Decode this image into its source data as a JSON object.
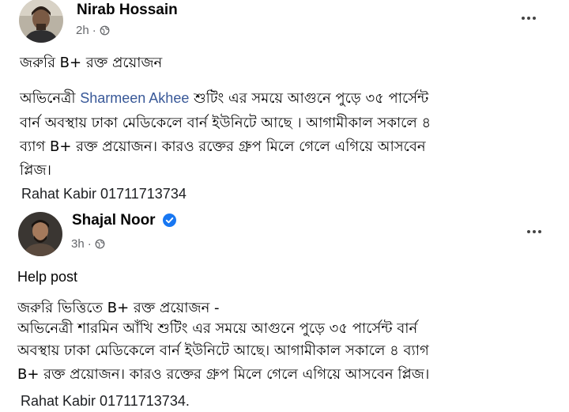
{
  "post1": {
    "author": "Nirab Hossain",
    "time": "2h",
    "separator": "·",
    "title": "জরুরি B+ রক্ত প্রয়োজন",
    "body_line1_prefix": "অভিনেত্রী",
    "body_line1_mention": "Sharmeen Akhee",
    "body_line1_suffix": "শুটিং এর সময়ে আগুনে পুড়ে ৩৫ পার্সেন্ট",
    "body_line2": "বার্ন অবস্থায় ঢাকা মেডিকেলে বার্ন ইউনিটে আছে । আগামীকাল সকালে ৪",
    "body_line3": "ব্যাগ B+ রক্ত প্রয়োজন। কারও রক্তের গ্রুপ মিলে গেলে এগিয়ে আসবেন",
    "body_line4": "প্লিজ।",
    "contact": "Rahat Kabir   01711713734",
    "icons": {
      "globe": "globe-icon",
      "more": "more-options-icon"
    }
  },
  "post2": {
    "author": "Shajal Noor",
    "time": "3h",
    "separator": "·",
    "intro": "Help post",
    "line1": "জরুরি ভিত্তিতে  B+ রক্ত প্রয়োজন -",
    "line2": "অভিনেত্রী শারমিন আঁখি শুটিং এর  সময়ে আগুনে পুড়ে ৩৫ পার্সেন্ট বার্ন",
    "line3": "অবস্থায় ঢাকা মেডিকেলে বার্ন ইউনিটে আছে। আগামীকাল সকালে ৪ ব্যাগ",
    "line4": "B+ রক্ত প্রয়োজন। কারও রক্তের গ্রুপ মিলে গেলে এগিয়ে আসবেন প্লিজ।",
    "contact": "Rahat Kabir   01711713734.",
    "icons": {
      "verified": "verified-badge-icon",
      "globe": "globe-icon",
      "more": "more-options-icon"
    }
  },
  "colors": {
    "text": "#050505",
    "secondary": "#65676b",
    "link": "#385898",
    "verified": "#1877f2"
  }
}
